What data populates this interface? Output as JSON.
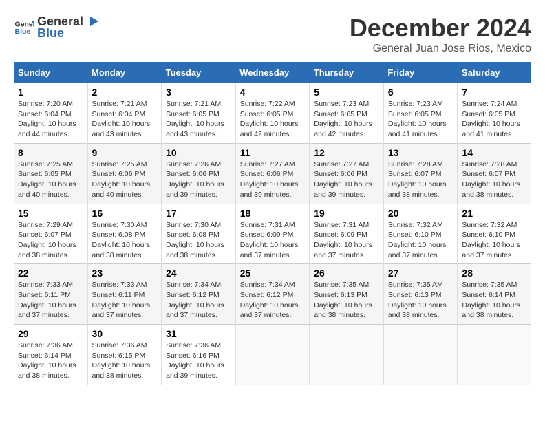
{
  "header": {
    "logo_general": "General",
    "logo_blue": "Blue",
    "title": "December 2024",
    "subtitle": "General Juan Jose Rios, Mexico"
  },
  "calendar": {
    "days_of_week": [
      "Sunday",
      "Monday",
      "Tuesday",
      "Wednesday",
      "Thursday",
      "Friday",
      "Saturday"
    ],
    "weeks": [
      [
        {
          "day": "",
          "info": ""
        },
        {
          "day": "2",
          "info": "Sunrise: 7:21 AM\nSunset: 6:04 PM\nDaylight: 10 hours\nand 43 minutes."
        },
        {
          "day": "3",
          "info": "Sunrise: 7:21 AM\nSunset: 6:05 PM\nDaylight: 10 hours\nand 43 minutes."
        },
        {
          "day": "4",
          "info": "Sunrise: 7:22 AM\nSunset: 6:05 PM\nDaylight: 10 hours\nand 42 minutes."
        },
        {
          "day": "5",
          "info": "Sunrise: 7:23 AM\nSunset: 6:05 PM\nDaylight: 10 hours\nand 42 minutes."
        },
        {
          "day": "6",
          "info": "Sunrise: 7:23 AM\nSunset: 6:05 PM\nDaylight: 10 hours\nand 41 minutes."
        },
        {
          "day": "7",
          "info": "Sunrise: 7:24 AM\nSunset: 6:05 PM\nDaylight: 10 hours\nand 41 minutes."
        }
      ],
      [
        {
          "day": "1",
          "info": "Sunrise: 7:20 AM\nSunset: 6:04 PM\nDaylight: 10 hours\nand 44 minutes."
        },
        {
          "day": "2",
          "info": "Sunrise: 7:21 AM\nSunset: 6:04 PM\nDaylight: 10 hours\nand 43 minutes."
        },
        {
          "day": "3",
          "info": "Sunrise: 7:21 AM\nSunset: 6:05 PM\nDaylight: 10 hours\nand 43 minutes."
        },
        {
          "day": "4",
          "info": "Sunrise: 7:22 AM\nSunset: 6:05 PM\nDaylight: 10 hours\nand 42 minutes."
        },
        {
          "day": "5",
          "info": "Sunrise: 7:23 AM\nSunset: 6:05 PM\nDaylight: 10 hours\nand 42 minutes."
        },
        {
          "day": "6",
          "info": "Sunrise: 7:23 AM\nSunset: 6:05 PM\nDaylight: 10 hours\nand 41 minutes."
        },
        {
          "day": "7",
          "info": "Sunrise: 7:24 AM\nSunset: 6:05 PM\nDaylight: 10 hours\nand 41 minutes."
        }
      ],
      [
        {
          "day": "8",
          "info": "Sunrise: 7:25 AM\nSunset: 6:05 PM\nDaylight: 10 hours\nand 40 minutes."
        },
        {
          "day": "9",
          "info": "Sunrise: 7:25 AM\nSunset: 6:06 PM\nDaylight: 10 hours\nand 40 minutes."
        },
        {
          "day": "10",
          "info": "Sunrise: 7:26 AM\nSunset: 6:06 PM\nDaylight: 10 hours\nand 39 minutes."
        },
        {
          "day": "11",
          "info": "Sunrise: 7:27 AM\nSunset: 6:06 PM\nDaylight: 10 hours\nand 39 minutes."
        },
        {
          "day": "12",
          "info": "Sunrise: 7:27 AM\nSunset: 6:06 PM\nDaylight: 10 hours\nand 39 minutes."
        },
        {
          "day": "13",
          "info": "Sunrise: 7:28 AM\nSunset: 6:07 PM\nDaylight: 10 hours\nand 38 minutes."
        },
        {
          "day": "14",
          "info": "Sunrise: 7:28 AM\nSunset: 6:07 PM\nDaylight: 10 hours\nand 38 minutes."
        }
      ],
      [
        {
          "day": "15",
          "info": "Sunrise: 7:29 AM\nSunset: 6:07 PM\nDaylight: 10 hours\nand 38 minutes."
        },
        {
          "day": "16",
          "info": "Sunrise: 7:30 AM\nSunset: 6:08 PM\nDaylight: 10 hours\nand 38 minutes."
        },
        {
          "day": "17",
          "info": "Sunrise: 7:30 AM\nSunset: 6:08 PM\nDaylight: 10 hours\nand 38 minutes."
        },
        {
          "day": "18",
          "info": "Sunrise: 7:31 AM\nSunset: 6:09 PM\nDaylight: 10 hours\nand 37 minutes."
        },
        {
          "day": "19",
          "info": "Sunrise: 7:31 AM\nSunset: 6:09 PM\nDaylight: 10 hours\nand 37 minutes."
        },
        {
          "day": "20",
          "info": "Sunrise: 7:32 AM\nSunset: 6:10 PM\nDaylight: 10 hours\nand 37 minutes."
        },
        {
          "day": "21",
          "info": "Sunrise: 7:32 AM\nSunset: 6:10 PM\nDaylight: 10 hours\nand 37 minutes."
        }
      ],
      [
        {
          "day": "22",
          "info": "Sunrise: 7:33 AM\nSunset: 6:11 PM\nDaylight: 10 hours\nand 37 minutes."
        },
        {
          "day": "23",
          "info": "Sunrise: 7:33 AM\nSunset: 6:11 PM\nDaylight: 10 hours\nand 37 minutes."
        },
        {
          "day": "24",
          "info": "Sunrise: 7:34 AM\nSunset: 6:12 PM\nDaylight: 10 hours\nand 37 minutes."
        },
        {
          "day": "25",
          "info": "Sunrise: 7:34 AM\nSunset: 6:12 PM\nDaylight: 10 hours\nand 37 minutes."
        },
        {
          "day": "26",
          "info": "Sunrise: 7:35 AM\nSunset: 6:13 PM\nDaylight: 10 hours\nand 38 minutes."
        },
        {
          "day": "27",
          "info": "Sunrise: 7:35 AM\nSunset: 6:13 PM\nDaylight: 10 hours\nand 38 minutes."
        },
        {
          "day": "28",
          "info": "Sunrise: 7:35 AM\nSunset: 6:14 PM\nDaylight: 10 hours\nand 38 minutes."
        }
      ],
      [
        {
          "day": "29",
          "info": "Sunrise: 7:36 AM\nSunset: 6:14 PM\nDaylight: 10 hours\nand 38 minutes."
        },
        {
          "day": "30",
          "info": "Sunrise: 7:36 AM\nSunset: 6:15 PM\nDaylight: 10 hours\nand 38 minutes."
        },
        {
          "day": "31",
          "info": "Sunrise: 7:36 AM\nSunset: 6:16 PM\nDaylight: 10 hours\nand 39 minutes."
        },
        {
          "day": "",
          "info": ""
        },
        {
          "day": "",
          "info": ""
        },
        {
          "day": "",
          "info": ""
        },
        {
          "day": "",
          "info": ""
        }
      ]
    ]
  }
}
